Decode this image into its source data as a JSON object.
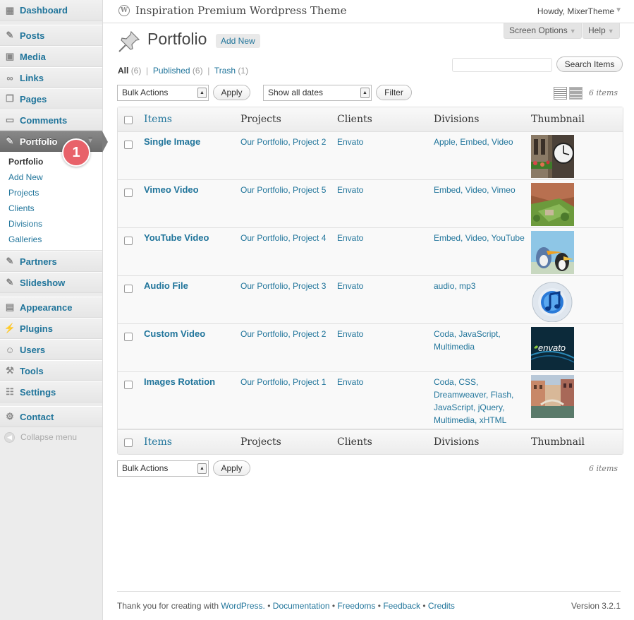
{
  "header": {
    "site_title": "Inspiration Premium Wordpress Theme",
    "howdy": "Howdy, MixerTheme",
    "screen_options": "Screen Options",
    "help": "Help"
  },
  "sidebar": {
    "dashboard": "Dashboard",
    "posts": "Posts",
    "media": "Media",
    "links": "Links",
    "pages": "Pages",
    "comments": "Comments",
    "portfolio": "Portfolio",
    "portfolio_sub": [
      "Portfolio",
      "Add New",
      "Projects",
      "Clients",
      "Divisions",
      "Galleries"
    ],
    "partners": "Partners",
    "slideshow": "Slideshow",
    "appearance": "Appearance",
    "plugins": "Plugins",
    "users": "Users",
    "tools": "Tools",
    "settings": "Settings",
    "contact": "Contact",
    "collapse": "Collapse menu",
    "badge": "1"
  },
  "main": {
    "title": "Portfolio",
    "add_new": "Add New",
    "filters": {
      "all": "All",
      "all_count": "(6)",
      "published": "Published",
      "published_count": "(6)",
      "trash": "Trash",
      "trash_count": "(1)"
    },
    "search_value": "",
    "search_button": "Search Items",
    "bulk_actions": "Bulk Actions",
    "apply": "Apply",
    "dates": "Show all dates",
    "filter": "Filter",
    "item_count": "6 items"
  },
  "table": {
    "columns": [
      "Items",
      "Projects",
      "Clients",
      "Divisions",
      "Thumbnail"
    ],
    "rows": [
      {
        "title": "Single Image",
        "projects": "Our Portfolio, Project 2",
        "client": "Envato",
        "divisions": "Apple, Embed, Video",
        "thumb": "clock-tower-photo"
      },
      {
        "title": "Vimeo Video",
        "projects": "Our Portfolio, Project 5",
        "client": "Envato",
        "divisions": "Embed, Video, Vimeo",
        "thumb": "garden-building-photo"
      },
      {
        "title": "YouTube Video",
        "projects": "Our Portfolio, Project 4",
        "client": "Envato",
        "divisions": "Embed, Video, YouTube",
        "thumb": "toucan-birds-photo"
      },
      {
        "title": "Audio File",
        "projects": "Our Portfolio, Project 3",
        "client": "Envato",
        "divisions": "audio, mp3",
        "thumb": "itunes-icon"
      },
      {
        "title": "Custom Video",
        "projects": "Our Portfolio, Project 2",
        "client": "Envato",
        "divisions": "Coda, JavaScript, Multimedia",
        "thumb": "envato-logo"
      },
      {
        "title": "Images Rotation",
        "projects": "Our Portfolio, Project 1",
        "client": "Envato",
        "divisions": "Coda, CSS, Dreamweaver, Flash, JavaScript, jQuery, Multimedia, xHTML",
        "thumb": "canal-city-photo"
      }
    ]
  },
  "footer": {
    "thanks": "Thank you for creating with",
    "wordpress": "WordPress.",
    "documentation": "Documentation",
    "freedoms": "Freedoms",
    "feedback": "Feedback",
    "credits": "Credits",
    "version": "Version 3.2.1"
  }
}
